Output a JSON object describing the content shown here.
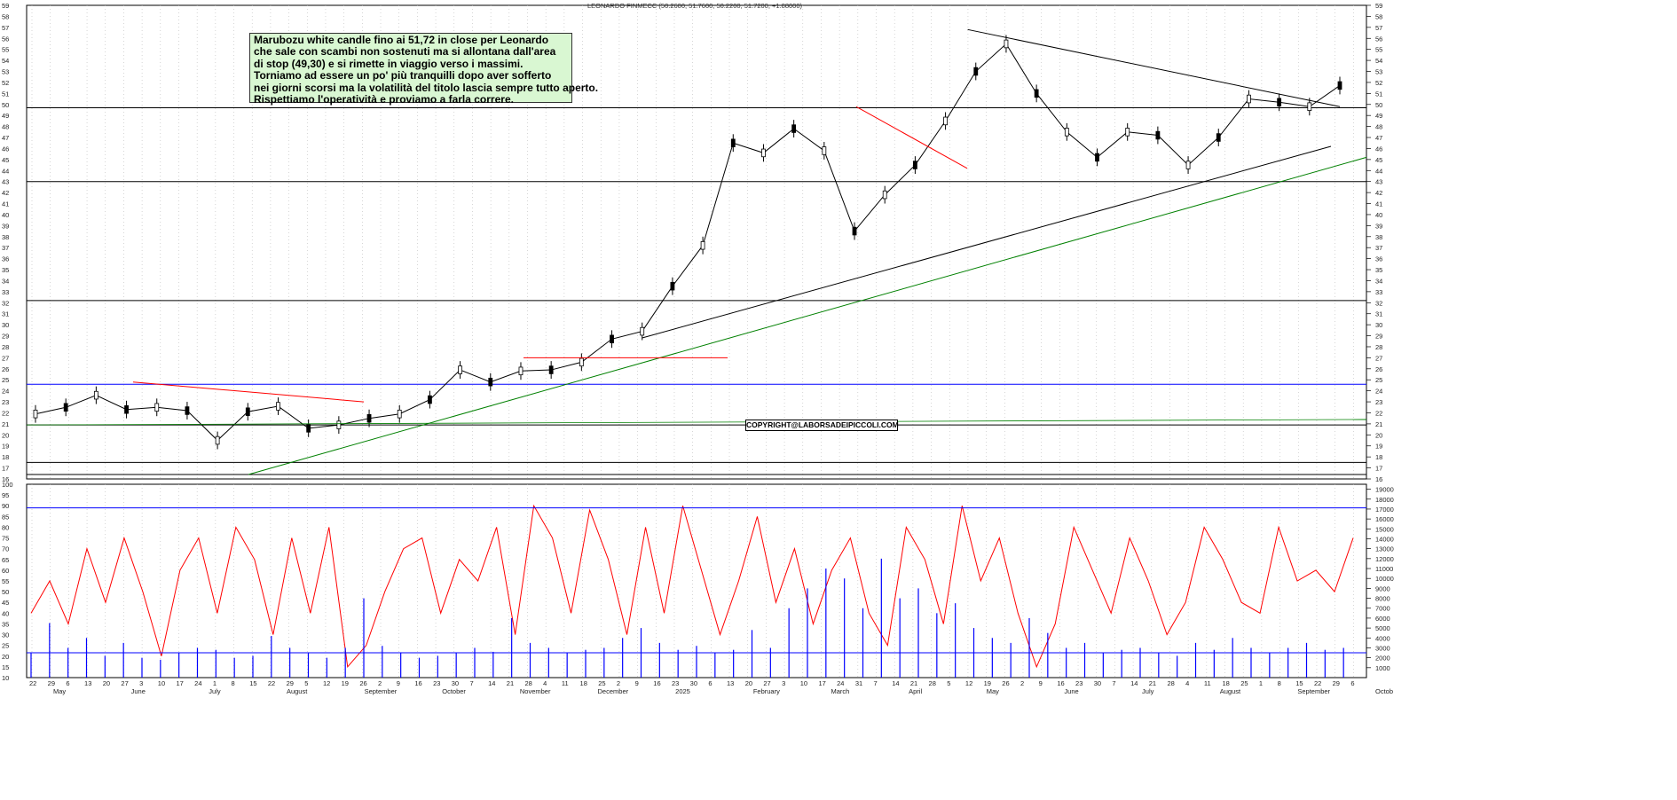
{
  "chart_title": "LEONARDO FINMECC (50.2600, 51.7600, 50.2200, 51.7200, +1.88000)",
  "note": {
    "lines": [
      "Marubozu white candle fino ai 51,72 in close per Leonardo",
      "che sale con scambi non sostenuti ma si allontana dall'area",
      "di stop (49,30) e si rimette in viaggio verso i massimi.",
      "Torniamo ad essere un po' più tranquilli dopo aver sofferto",
      "nei giorni scorsi ma la volatilità del titolo lascia sempre tutto aperto.",
      "Rispettiamo l'operatività e proviamo a farla correre."
    ]
  },
  "copyright": "COPYRIGHT@LABORSADEIPICCOLI.COM",
  "colors": {
    "price_line": "#000000",
    "resistance_blue": "#0000ff",
    "trend_green": "#008000",
    "trend_red": "#ff0000",
    "rsi": "#ff0000",
    "volume": "#0000ff",
    "note_bg": "#d9f7d2"
  },
  "chart_data": [
    {
      "type": "line",
      "title": "LEONARDO FINMECC (50.2600, 51.7600, 50.2200, 51.7200, +1.88000)",
      "ylim": [
        16,
        59
      ],
      "y_ticks": [
        16,
        17,
        18,
        19,
        20,
        21,
        22,
        23,
        24,
        25,
        26,
        27,
        28,
        29,
        30,
        31,
        32,
        33,
        34,
        35,
        36,
        37,
        38,
        39,
        40,
        41,
        42,
        43,
        44,
        45,
        46,
        47,
        48,
        49,
        50,
        51,
        52,
        53,
        54,
        55,
        56,
        57,
        58,
        59
      ],
      "x": [
        "2024-05-22",
        "2024-06-05",
        "2024-06-19",
        "2024-07-03",
        "2024-07-17",
        "2024-07-31",
        "2024-08-05",
        "2024-08-19",
        "2024-09-02",
        "2024-09-16",
        "2024-09-30",
        "2024-10-14",
        "2024-10-28",
        "2024-11-04",
        "2024-11-11",
        "2024-11-25",
        "2024-12-09",
        "2024-12-23",
        "2025-01-06",
        "2025-01-20",
        "2025-02-03",
        "2025-02-10",
        "2025-02-17",
        "2025-02-24",
        "2025-03-03",
        "2025-03-10",
        "2025-03-17",
        "2025-03-31",
        "2025-04-07",
        "2025-04-14",
        "2025-04-28",
        "2025-05-12",
        "2025-05-26",
        "2025-06-02",
        "2025-06-16",
        "2025-06-30",
        "2025-07-14",
        "2025-07-28",
        "2025-08-11",
        "2025-08-18",
        "2025-09-01",
        "2025-09-08",
        "2025-09-15",
        "2025-09-22"
      ],
      "close": [
        21.9,
        22.5,
        23.6,
        22.3,
        22.5,
        22.2,
        19.5,
        22.1,
        22.6,
        20.6,
        20.9,
        21.5,
        21.9,
        23.2,
        25.9,
        24.8,
        25.8,
        25.9,
        26.6,
        28.7,
        29.4,
        33.5,
        37.2,
        46.5,
        45.6,
        47.8,
        45.8,
        38.5,
        41.8,
        44.5,
        48.5,
        53.0,
        55.5,
        51.0,
        47.5,
        45.2,
        47.5,
        47.2,
        44.5,
        47.0,
        50.5,
        50.2,
        49.8,
        51.72
      ],
      "horizontal_levels": [
        16.4,
        17.5,
        20.9,
        24.6,
        32.2,
        43.0,
        49.7
      ],
      "x_labels_days": [
        "22",
        "29",
        "6",
        "13",
        "20",
        "27",
        "3",
        "10",
        "17",
        "24",
        "1",
        "8",
        "15",
        "22",
        "29",
        "5",
        "12",
        "19",
        "26",
        "2",
        "9",
        "16",
        "23",
        "30",
        "7",
        "14",
        "21",
        "28",
        "4",
        "11",
        "18",
        "25",
        "2",
        "9",
        "16",
        "23",
        "30",
        "6",
        "13",
        "20",
        "27",
        "3",
        "10",
        "17",
        "24",
        "31",
        "7",
        "14",
        "21",
        "28",
        "5",
        "12",
        "19",
        "26",
        "2",
        "9",
        "16",
        "23",
        "30",
        "7",
        "14",
        "21",
        "28",
        "4",
        "11",
        "18",
        "25",
        "1",
        "8",
        "15",
        "22",
        "29",
        "6"
      ],
      "x_labels_months": [
        "May",
        "June",
        "July",
        "August",
        "September",
        "October",
        "November",
        "December",
        "2025",
        "February",
        "March",
        "April",
        "May",
        "June",
        "July",
        "August",
        "September",
        "Octob"
      ]
    },
    {
      "type": "line",
      "name": "RSI",
      "ylim": [
        10,
        100
      ],
      "y_ticks": [
        10,
        15,
        20,
        25,
        30,
        35,
        40,
        45,
        50,
        55,
        60,
        65,
        70,
        75,
        80,
        85,
        90,
        95,
        100
      ],
      "reference_level": 89,
      "values": [
        40,
        55,
        35,
        70,
        45,
        75,
        50,
        20,
        60,
        75,
        40,
        80,
        65,
        30,
        75,
        40,
        80,
        15,
        25,
        50,
        70,
        75,
        40,
        65,
        55,
        80,
        30,
        90,
        75,
        40,
        88,
        65,
        30,
        80,
        40,
        90,
        60,
        30,
        55,
        85,
        45,
        70,
        35,
        60,
        75,
        40,
        25,
        80,
        65,
        35,
        90,
        55,
        75,
        40,
        15,
        35,
        80,
        60,
        40,
        75,
        55,
        30,
        45,
        80,
        65,
        45,
        40,
        80,
        55,
        60,
        50,
        75
      ]
    },
    {
      "type": "bar",
      "name": "Volume",
      "ylim": [
        0,
        19500
      ],
      "y_ticks": [
        1000,
        2000,
        3000,
        4000,
        5000,
        6000,
        7000,
        8000,
        9000,
        10000,
        11000,
        12000,
        13000,
        14000,
        15000,
        16000,
        17000,
        18000,
        19000
      ],
      "reference_level": 2500,
      "values": [
        2500,
        5500,
        3000,
        4000,
        2200,
        3500,
        2000,
        1800,
        2500,
        3000,
        2800,
        2000,
        2200,
        4200,
        3000,
        2500,
        2000,
        3000,
        8000,
        3200,
        2500,
        2000,
        2200,
        2500,
        3000,
        2600,
        6000,
        3500,
        3000,
        2500,
        2800,
        3000,
        4000,
        5000,
        3500,
        2800,
        3200,
        2500,
        2800,
        4800,
        3000,
        7000,
        9000,
        11000,
        10000,
        7000,
        12000,
        8000,
        9000,
        6500,
        7500,
        5000,
        4000,
        3500,
        6000,
        4500,
        3000,
        3500,
        2500,
        2800,
        3000,
        2500,
        2200,
        3500,
        2800,
        4000,
        3000,
        2500,
        3000,
        3500,
        2800,
        3000
      ]
    }
  ]
}
